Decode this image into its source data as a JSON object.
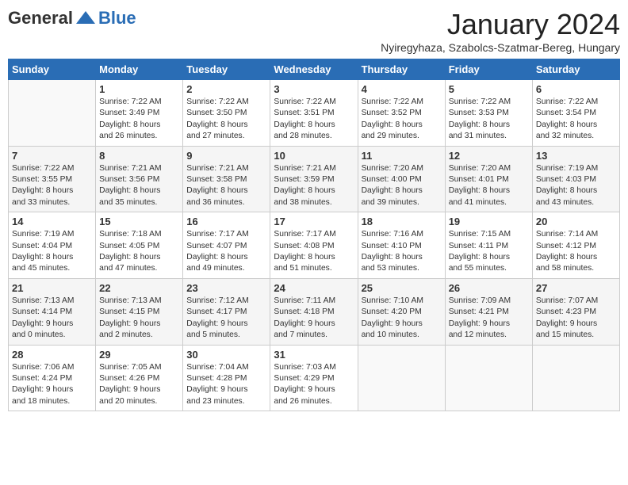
{
  "header": {
    "logo_general": "General",
    "logo_blue": "Blue",
    "month_title": "January 2024",
    "location": "Nyiregyhaza, Szabolcs-Szatmar-Bereg, Hungary"
  },
  "days_of_week": [
    "Sunday",
    "Monday",
    "Tuesday",
    "Wednesday",
    "Thursday",
    "Friday",
    "Saturday"
  ],
  "weeks": [
    [
      {
        "day": "",
        "lines": []
      },
      {
        "day": "1",
        "lines": [
          "Sunrise: 7:22 AM",
          "Sunset: 3:49 PM",
          "Daylight: 8 hours",
          "and 26 minutes."
        ]
      },
      {
        "day": "2",
        "lines": [
          "Sunrise: 7:22 AM",
          "Sunset: 3:50 PM",
          "Daylight: 8 hours",
          "and 27 minutes."
        ]
      },
      {
        "day": "3",
        "lines": [
          "Sunrise: 7:22 AM",
          "Sunset: 3:51 PM",
          "Daylight: 8 hours",
          "and 28 minutes."
        ]
      },
      {
        "day": "4",
        "lines": [
          "Sunrise: 7:22 AM",
          "Sunset: 3:52 PM",
          "Daylight: 8 hours",
          "and 29 minutes."
        ]
      },
      {
        "day": "5",
        "lines": [
          "Sunrise: 7:22 AM",
          "Sunset: 3:53 PM",
          "Daylight: 8 hours",
          "and 31 minutes."
        ]
      },
      {
        "day": "6",
        "lines": [
          "Sunrise: 7:22 AM",
          "Sunset: 3:54 PM",
          "Daylight: 8 hours",
          "and 32 minutes."
        ]
      }
    ],
    [
      {
        "day": "7",
        "lines": [
          "Sunrise: 7:22 AM",
          "Sunset: 3:55 PM",
          "Daylight: 8 hours",
          "and 33 minutes."
        ]
      },
      {
        "day": "8",
        "lines": [
          "Sunrise: 7:21 AM",
          "Sunset: 3:56 PM",
          "Daylight: 8 hours",
          "and 35 minutes."
        ]
      },
      {
        "day": "9",
        "lines": [
          "Sunrise: 7:21 AM",
          "Sunset: 3:58 PM",
          "Daylight: 8 hours",
          "and 36 minutes."
        ]
      },
      {
        "day": "10",
        "lines": [
          "Sunrise: 7:21 AM",
          "Sunset: 3:59 PM",
          "Daylight: 8 hours",
          "and 38 minutes."
        ]
      },
      {
        "day": "11",
        "lines": [
          "Sunrise: 7:20 AM",
          "Sunset: 4:00 PM",
          "Daylight: 8 hours",
          "and 39 minutes."
        ]
      },
      {
        "day": "12",
        "lines": [
          "Sunrise: 7:20 AM",
          "Sunset: 4:01 PM",
          "Daylight: 8 hours",
          "and 41 minutes."
        ]
      },
      {
        "day": "13",
        "lines": [
          "Sunrise: 7:19 AM",
          "Sunset: 4:03 PM",
          "Daylight: 8 hours",
          "and 43 minutes."
        ]
      }
    ],
    [
      {
        "day": "14",
        "lines": [
          "Sunrise: 7:19 AM",
          "Sunset: 4:04 PM",
          "Daylight: 8 hours",
          "and 45 minutes."
        ]
      },
      {
        "day": "15",
        "lines": [
          "Sunrise: 7:18 AM",
          "Sunset: 4:05 PM",
          "Daylight: 8 hours",
          "and 47 minutes."
        ]
      },
      {
        "day": "16",
        "lines": [
          "Sunrise: 7:17 AM",
          "Sunset: 4:07 PM",
          "Daylight: 8 hours",
          "and 49 minutes."
        ]
      },
      {
        "day": "17",
        "lines": [
          "Sunrise: 7:17 AM",
          "Sunset: 4:08 PM",
          "Daylight: 8 hours",
          "and 51 minutes."
        ]
      },
      {
        "day": "18",
        "lines": [
          "Sunrise: 7:16 AM",
          "Sunset: 4:10 PM",
          "Daylight: 8 hours",
          "and 53 minutes."
        ]
      },
      {
        "day": "19",
        "lines": [
          "Sunrise: 7:15 AM",
          "Sunset: 4:11 PM",
          "Daylight: 8 hours",
          "and 55 minutes."
        ]
      },
      {
        "day": "20",
        "lines": [
          "Sunrise: 7:14 AM",
          "Sunset: 4:12 PM",
          "Daylight: 8 hours",
          "and 58 minutes."
        ]
      }
    ],
    [
      {
        "day": "21",
        "lines": [
          "Sunrise: 7:13 AM",
          "Sunset: 4:14 PM",
          "Daylight: 9 hours",
          "and 0 minutes."
        ]
      },
      {
        "day": "22",
        "lines": [
          "Sunrise: 7:13 AM",
          "Sunset: 4:15 PM",
          "Daylight: 9 hours",
          "and 2 minutes."
        ]
      },
      {
        "day": "23",
        "lines": [
          "Sunrise: 7:12 AM",
          "Sunset: 4:17 PM",
          "Daylight: 9 hours",
          "and 5 minutes."
        ]
      },
      {
        "day": "24",
        "lines": [
          "Sunrise: 7:11 AM",
          "Sunset: 4:18 PM",
          "Daylight: 9 hours",
          "and 7 minutes."
        ]
      },
      {
        "day": "25",
        "lines": [
          "Sunrise: 7:10 AM",
          "Sunset: 4:20 PM",
          "Daylight: 9 hours",
          "and 10 minutes."
        ]
      },
      {
        "day": "26",
        "lines": [
          "Sunrise: 7:09 AM",
          "Sunset: 4:21 PM",
          "Daylight: 9 hours",
          "and 12 minutes."
        ]
      },
      {
        "day": "27",
        "lines": [
          "Sunrise: 7:07 AM",
          "Sunset: 4:23 PM",
          "Daylight: 9 hours",
          "and 15 minutes."
        ]
      }
    ],
    [
      {
        "day": "28",
        "lines": [
          "Sunrise: 7:06 AM",
          "Sunset: 4:24 PM",
          "Daylight: 9 hours",
          "and 18 minutes."
        ]
      },
      {
        "day": "29",
        "lines": [
          "Sunrise: 7:05 AM",
          "Sunset: 4:26 PM",
          "Daylight: 9 hours",
          "and 20 minutes."
        ]
      },
      {
        "day": "30",
        "lines": [
          "Sunrise: 7:04 AM",
          "Sunset: 4:28 PM",
          "Daylight: 9 hours",
          "and 23 minutes."
        ]
      },
      {
        "day": "31",
        "lines": [
          "Sunrise: 7:03 AM",
          "Sunset: 4:29 PM",
          "Daylight: 9 hours",
          "and 26 minutes."
        ]
      },
      {
        "day": "",
        "lines": []
      },
      {
        "day": "",
        "lines": []
      },
      {
        "day": "",
        "lines": []
      }
    ]
  ]
}
